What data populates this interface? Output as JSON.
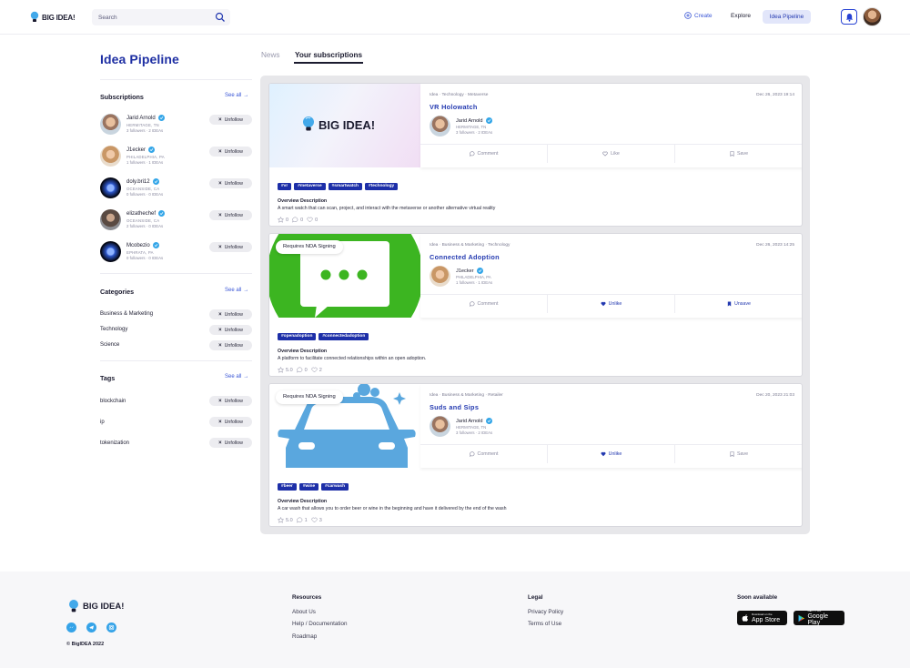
{
  "header": {
    "brand": "BIG IDEA!",
    "search_placeholder": "Search",
    "nav": {
      "create": "Create",
      "explore": "Explore",
      "pipeline": "Idea Pipeline"
    }
  },
  "sidebar": {
    "title": "Idea Pipeline",
    "subscriptions": {
      "title": "Subscriptions",
      "see_all": "See all",
      "items": [
        {
          "name": "Jarid Arnold",
          "location": "HERMITAGE, TN",
          "stats": "3 followers · 2 IDEAs",
          "button": "Unfollow"
        },
        {
          "name": "J1ecker",
          "location": "PHILADELPHIA, PA",
          "stats": "1 followers · 1 IDEAs",
          "button": "Unfollow"
        },
        {
          "name": "doly.bri12",
          "location": "OCEANSIDE, CA",
          "stats": "0 followers · 0 IDEAs",
          "button": "Unfollow"
        },
        {
          "name": "elizathechef",
          "location": "OCEANSIDE, CA",
          "stats": "2 followers · 0 IDEAs",
          "button": "Unfollow"
        },
        {
          "name": "Mcobezio",
          "location": "EPHRATA, PA",
          "stats": "0 followers · 0 IDEAs",
          "button": "Unfollow"
        }
      ]
    },
    "categories": {
      "title": "Categories",
      "see_all": "See all",
      "items": [
        {
          "label": "Business & Marketing",
          "button": "Unfollow"
        },
        {
          "label": "Technology",
          "button": "Unfollow"
        },
        {
          "label": "Science",
          "button": "Unfollow"
        }
      ]
    },
    "tags": {
      "title": "Tags",
      "see_all": "See all",
      "items": [
        {
          "label": "blockchain",
          "button": "Unfollow"
        },
        {
          "label": "ip",
          "button": "Unfollow"
        },
        {
          "label": "tokenization",
          "button": "Unfollow"
        }
      ]
    }
  },
  "tabs": {
    "news": "News",
    "subscriptions": "Your subscriptions"
  },
  "cards": [
    {
      "crumbs": "Idea · Technology · Metaverse",
      "date": "Dec 26, 2023 19:14",
      "title": "VR Holowatch",
      "author": "Jarid Arnold",
      "author_location": "HERMITAGE, TN",
      "author_stats": "3 followers · 2 IDEAs",
      "actions": {
        "comment": "Comment",
        "like": "Like",
        "save": "Save"
      },
      "image_brand": "BIG IDEA!",
      "tags": [
        "#vr",
        "#metaverse",
        "#smartwatch",
        "#technology"
      ],
      "overview_label": "Overview Description",
      "overview": "A smart watch that can scan, project, and interact with the metaverse or another alternative virtual reality",
      "rating": "0",
      "comments": "0",
      "likes": "0"
    },
    {
      "badge": "Requires NDA Signing",
      "crumbs": "Idea · Business & Marketing · Technology",
      "date": "Dec 26, 2023 14:25",
      "title": "Connected Adoption",
      "author": "J1ecker",
      "author_location": "PHILADELPHIA, PA",
      "author_stats": "1 followers · 1 IDEAs",
      "actions": {
        "comment": "Comment",
        "like": "Unlike",
        "save": "Unsave"
      },
      "tags": [
        "#openadoption",
        "#connectedadoption"
      ],
      "overview_label": "Overview Description",
      "overview": "A platform to facilitate connected relationships within an open adoption.",
      "rating": "5.0",
      "comments": "0",
      "likes": "2"
    },
    {
      "badge": "Requires NDA Signing",
      "crumbs": "Idea · Business & Marketing · Retailer",
      "date": "Dec 20, 2023 21:03",
      "title": "Suds and Sips",
      "author": "Jarid Arnold",
      "author_location": "HERMITAGE, TN",
      "author_stats": "3 followers · 2 IDEAs",
      "actions": {
        "comment": "Comment",
        "like": "Unlike",
        "save": "Save"
      },
      "tags": [
        "#beer",
        "#wine",
        "#carwash"
      ],
      "overview_label": "Overview Description",
      "overview": "A car wash that allows you to order beer or wine in the beginning and have it delivered by the end of the wash",
      "rating": "5.0",
      "comments": "1",
      "likes": "3"
    }
  ],
  "footer": {
    "brand": "BIG IDEA!",
    "copyright": "© BigIDEA 2022",
    "resources": {
      "title": "Resources",
      "links": [
        "About Us",
        "Help / Documentation",
        "Roadmap"
      ]
    },
    "legal": {
      "title": "Legal",
      "links": [
        "Privacy Policy",
        "Terms of Use"
      ]
    },
    "soon": {
      "title": "Soon available"
    },
    "app_store": {
      "small": "Download on the",
      "big": "App Store"
    },
    "google_play": {
      "small": "GET IT ON",
      "big": "Google Play"
    }
  },
  "colors": {
    "brand_blue": "#2339b0",
    "accent": "#3a56d6",
    "verified": "#34a6e8",
    "nda_green": "#3cb521",
    "car_blue": "#5aa7de"
  }
}
